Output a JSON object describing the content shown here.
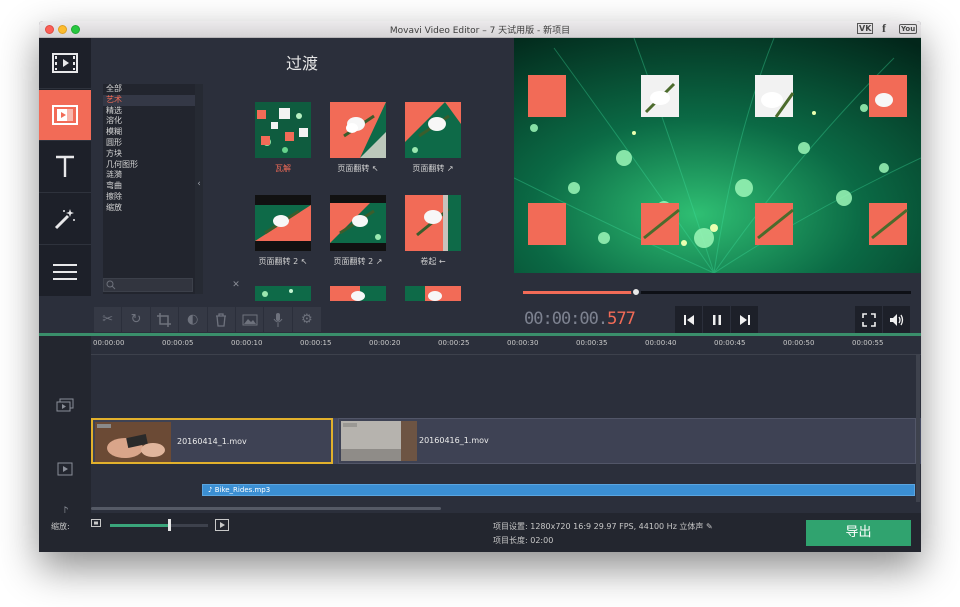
{
  "window": {
    "title": "Movavi Video Editor – 7 天试用版 - 新项目",
    "social": {
      "vk": "VK",
      "facebook": "f",
      "youtube": "You"
    }
  },
  "sidebar": {
    "tools": [
      {
        "name": "media-import",
        "icon": "film-icon",
        "active": false
      },
      {
        "name": "transitions",
        "icon": "transition-icon",
        "active": true
      },
      {
        "name": "titles",
        "icon": "text-t-icon",
        "active": false
      },
      {
        "name": "filters",
        "icon": "magic-wand-icon",
        "active": false
      },
      {
        "name": "more",
        "icon": "hamburger-icon",
        "active": false
      }
    ]
  },
  "transitions": {
    "title": "过渡",
    "categories": [
      "全部",
      "艺术",
      "精选",
      "溶化",
      "模糊",
      "圆形",
      "方块",
      "几何图形",
      "涟漪",
      "弯曲",
      "擦除",
      "缩放"
    ],
    "selected_category": "艺术",
    "items": [
      {
        "label": "瓦解",
        "selected": true
      },
      {
        "label": "页面翻转 ↖",
        "selected": false
      },
      {
        "label": "页面翻转 ↗",
        "selected": false
      },
      {
        "label": "页面翻转 2 ↖",
        "selected": false
      },
      {
        "label": "页面翻转 2 ↗",
        "selected": false
      },
      {
        "label": "卷起 ←",
        "selected": false
      },
      {
        "label": "",
        "selected": false
      },
      {
        "label": "",
        "selected": false
      },
      {
        "label": "",
        "selected": false
      }
    ]
  },
  "player": {
    "timecode_main": "00:00:00.",
    "timecode_ms": "577",
    "progress": 0.29,
    "buttons": [
      "skip-back-icon",
      "pause-icon",
      "skip-forward-icon",
      "fullscreen-icon",
      "volume-icon"
    ]
  },
  "edit_toolbar": [
    "scissors-icon",
    "rotate-icon",
    "crop-icon",
    "color-adjust-icon",
    "trash-icon",
    "image-icon",
    "microphone-icon",
    "gear-icon"
  ],
  "timeline": {
    "ruler": [
      "00:00:00",
      "00:00:05",
      "00:00:10",
      "00:00:15",
      "00:00:20",
      "00:00:25",
      "00:00:30",
      "00:00:35",
      "00:00:40",
      "00:00:45",
      "00:00:50",
      "00:00:55"
    ],
    "clips": [
      {
        "name": "20160414_1.mov",
        "selected": true
      },
      {
        "name": "20160416_1.mov",
        "selected": false
      }
    ],
    "audio": {
      "name": "Bike_Rides.mp3"
    }
  },
  "status": {
    "zoom_label": "缩放:",
    "zoom_level": 0.6,
    "project_settings": "项目设置:  1280x720 16:9 29.97 FPS, 44100 Hz 立体声",
    "project_length": "项目长度:  02:00",
    "export_label": "导出"
  },
  "colors": {
    "accent": "#f26b57",
    "export": "#30a36f",
    "audio": "#3b8fd3",
    "selection": "#e2b12c"
  }
}
